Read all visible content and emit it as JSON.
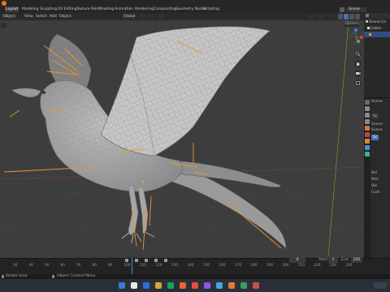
{
  "topbar": {
    "menus": [],
    "workspace_tabs": [
      "Layout",
      "Modeling",
      "Sculpting",
      "UV Editing",
      "Texture Paint",
      "Shading",
      "Animation",
      "Rendering",
      "Compositing",
      "Geometry Nodes",
      "Scripting"
    ],
    "active_tab": "Layout",
    "scene_label": "Scene",
    "scene_short": "Sc"
  },
  "viewport_header": {
    "mode": "Object",
    "menus": [
      "View",
      "Select",
      "Add",
      "Object"
    ],
    "transform_orientation": "Global",
    "options_label": "Options",
    "gizmo_axes": {
      "x": "X",
      "y": "Y",
      "z": "Z"
    }
  },
  "outliner": {
    "header": "Scene Co",
    "rows": [
      {
        "label": "Scene Co",
        "selected": false
      },
      {
        "label": "Collec",
        "selected": false
      },
      {
        "label": "",
        "selected": true
      }
    ]
  },
  "properties": {
    "rows": [
      "Scene",
      "Sc",
      "Scene",
      "Scene",
      "Sc",
      "Rel",
      "Mot",
      "Vie",
      "Cust"
    ]
  },
  "timeline": {
    "ruler_numbers": [
      "30",
      "40",
      "50",
      "60",
      "70",
      "80",
      "90",
      "100",
      "110",
      "120",
      "130",
      "140",
      "150",
      "160",
      "170",
      "180",
      "190",
      "200",
      "210",
      "220",
      "230",
      "240"
    ],
    "current_frame": "0",
    "start_label": "Start",
    "start_value": "1",
    "end_label": "End",
    "end_value": "250"
  },
  "statusbar": {
    "left": "Rotate View",
    "middle": "Object Context Menu"
  },
  "taskbar": {
    "clock": "",
    "icon_colors": [
      "#3a7bd5",
      "#e8e8e8",
      "#2f6bd8",
      "#d9a33a",
      "#1aa35a",
      "#e6662c",
      "#e84c3d",
      "#8c5ad8",
      "#4aa3df",
      "#e07b39",
      "#3c9c5c",
      "#c94f4f"
    ]
  },
  "colors": {
    "accent": "#4772b3",
    "bone": "#e6972e",
    "mesh": "#a9a9a9"
  }
}
